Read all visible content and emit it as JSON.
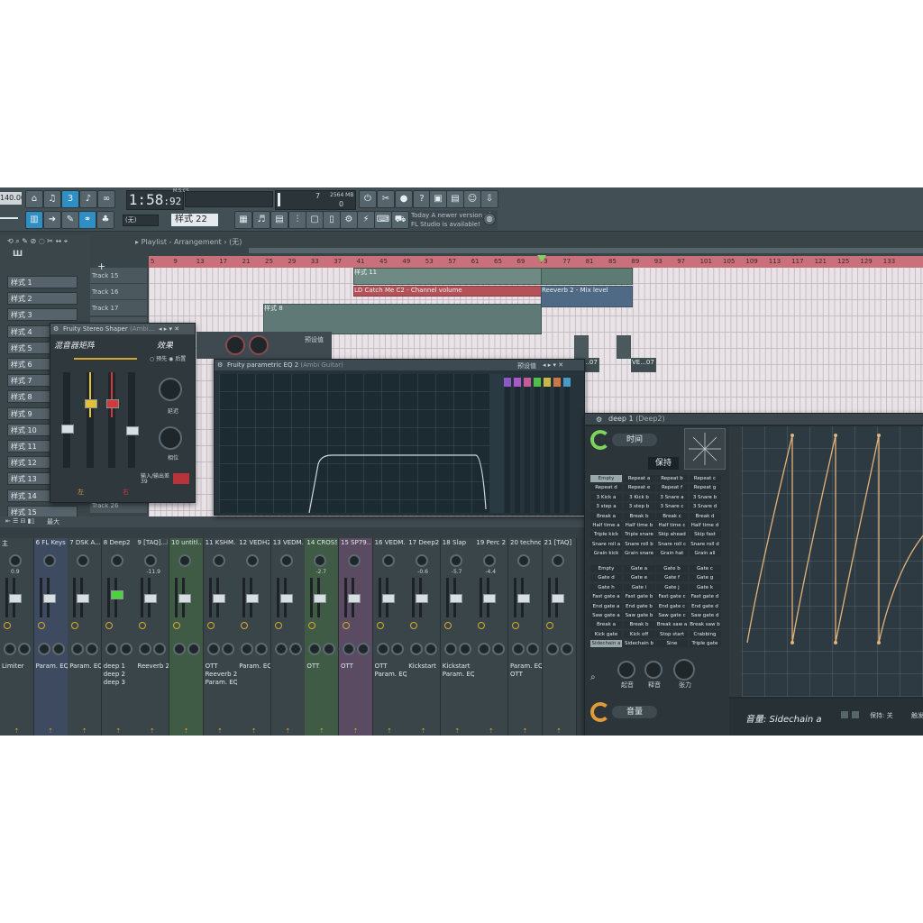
{
  "toolbar": {
    "tempo": "140.000",
    "time_main": "1:58",
    "time_sub": "92",
    "time_unit": "M:S:CS",
    "cpu_value": "7",
    "memory": "2564 MB",
    "poly_value": "0",
    "pattern_selector": "样式 22",
    "snap_value": "(无)",
    "news_line1": "Today  A newer version of",
    "news_line2": "FL Studio is available!"
  },
  "browser": {
    "patterns": [
      "样式 1",
      "样式 2",
      "样式 3",
      "样式 4",
      "样式 5",
      "样式 6",
      "样式 7",
      "样式 8",
      "样式 9",
      "样式 10",
      "样式 11",
      "样式 12",
      "样式 13",
      "样式 14",
      "样式 15"
    ]
  },
  "playlist": {
    "breadcrumb": "Playlist - Arrangement",
    "breadcrumb_sub": "(无)",
    "ruler": [
      "5",
      "9",
      "13",
      "17",
      "21",
      "25",
      "29",
      "33",
      "37",
      "41",
      "45",
      "49",
      "53",
      "57",
      "61",
      "65",
      "69",
      "73",
      "77",
      "81",
      "85",
      "89",
      "93",
      "97",
      "101",
      "105",
      "109",
      "113",
      "117",
      "121",
      "125",
      "129",
      "133"
    ],
    "tracks": [
      "Track 15",
      "Track 16",
      "Track 17",
      "",
      "",
      "",
      "",
      "",
      "",
      "",
      "",
      "",
      "",
      "",
      "Track 26"
    ],
    "clips": {
      "pattern_11": "样式 11",
      "lp_catch": "LD Catch Me C2 - Channel volume",
      "reverb": "Reeverb 2 - Mix level",
      "pattern_8": "样式 8",
      "ve_a": "VE...07",
      "ve_b": "VE...07"
    }
  },
  "stereo_shaper": {
    "title": "Fruity Stereo Shaper",
    "title_sub": "(Ambi...",
    "label_mix": "混音器矩阵",
    "label_effect": "效果",
    "radio_pre": "预先",
    "radio_post": "后置",
    "knob_delay": "延迟",
    "knob_phase": "相位",
    "io_label": "输入/输出差",
    "io_value": "39",
    "left": "左",
    "right": "右"
  },
  "eq": {
    "title": "Fruity parametric EQ 2",
    "title_sub": "(Ambi Guitar)",
    "preset_label": "预设值",
    "top_preset": "预设值"
  },
  "sidechain": {
    "title": "deep 1",
    "title_sub": "(Deep2)",
    "time_label": "时间",
    "hold_label": "保持",
    "volume_label": "音量",
    "presets_top": [
      [
        "Empty",
        "Repeat a",
        "Repeat b",
        "Repeat c"
      ],
      [
        "Repeat d",
        "Repeat e",
        "Repeat f",
        "Repeat g"
      ],
      [
        "3 Kick a",
        "3 Kick b",
        "3 Snare a",
        "3 Snare b"
      ],
      [
        "3 step a",
        "3 step b",
        "3 Snare c",
        "3 Snare d"
      ],
      [
        "Break a",
        "Break b",
        "Break c",
        "Break d"
      ],
      [
        "Half time a",
        "Half time b",
        "Half time c",
        "Half time d"
      ],
      [
        "Triple kick",
        "Triple snare",
        "Skip ahead",
        "Skip fast"
      ],
      [
        "Snare roll a",
        "Snare roll b",
        "Snare roll c",
        "Snare roll d"
      ],
      [
        "Grain kick",
        "Grain snare",
        "Grain hat",
        "Grain all"
      ]
    ],
    "presets_bottom": [
      [
        "Empty",
        "Gate a",
        "Gate b",
        "Gate c"
      ],
      [
        "Gate d",
        "Gate e",
        "Gate f",
        "Gate g"
      ],
      [
        "Gate h",
        "Gate i",
        "Gate j",
        "Gate k"
      ],
      [
        "Fast gate a",
        "Fast gate b",
        "Fast gate c",
        "Fast gate d"
      ],
      [
        "End gate a",
        "End gate b",
        "End gate c",
        "End gate d"
      ],
      [
        "Saw gate a",
        "Saw gate b",
        "Saw gate c",
        "Saw gate d"
      ],
      [
        "Break a",
        "Break b",
        "Break saw a",
        "Break saw b"
      ],
      [
        "Kick gate",
        "Kick off",
        "Stop start",
        "Crabbing"
      ],
      [
        "Sidechain a",
        "Sidechain b",
        "Sine",
        "Triple gate"
      ]
    ],
    "knob_attack": "起音",
    "knob_release": "释音",
    "knob_tension": "张力",
    "curve_label": "音量: Sidechain a",
    "hold_setting": "保持: 关",
    "trigger": "触发"
  },
  "mixer": {
    "header": "最大",
    "strips": [
      {
        "num": "",
        "name": "主",
        "db": "0.9",
        "slots": [
          "Limiter"
        ],
        "color": "#3a454a"
      },
      {
        "num": "6",
        "name": "FL Keys",
        "db": "",
        "slots": [
          "Param. EQ 2"
        ],
        "color": "#3e4a60"
      },
      {
        "num": "7",
        "name": "DSK A...am2",
        "db": "",
        "slots": [
          "Param. EQ 2"
        ],
        "color": "#3a454a"
      },
      {
        "num": "8",
        "name": "Deep2",
        "db": "",
        "slots": [
          "deep 1",
          "deep 2",
          "deep 3"
        ],
        "color": "#3a454a"
      },
      {
        "num": "9",
        "name": "[TAQ]...bstep",
        "db": "-11.9",
        "slots": [
          "Reeverb 2"
        ],
        "color": "#3a454a"
      },
      {
        "num": "10",
        "name": "untitl...aster",
        "db": "",
        "slots": [],
        "color": "#3f5a45"
      },
      {
        "num": "11",
        "name": "KSHM...05_A",
        "db": "",
        "slots": [
          "OTT",
          "Reeverb 2",
          "Param. EQ 2"
        ],
        "color": "#3a454a"
      },
      {
        "num": "12",
        "name": "VEDH2...43 C",
        "db": "",
        "slots": [
          "Param. EQ 2"
        ],
        "color": "#3a454a"
      },
      {
        "num": "13",
        "name": "VEDM...26 B",
        "db": "",
        "slots": [],
        "color": "#3a454a"
      },
      {
        "num": "14",
        "name": "CROSS...Killa",
        "db": "-2.7",
        "slots": [
          "OTT"
        ],
        "color": "#3f5a45"
      },
      {
        "num": "15",
        "name": "SP79...ps 21",
        "db": "",
        "slots": [
          "OTT"
        ],
        "color": "#5a4a62"
      },
      {
        "num": "16",
        "name": "VEDM...7 (C)",
        "db": "",
        "slots": [
          "OTT",
          "Param. EQ 2"
        ],
        "color": "#3a454a"
      },
      {
        "num": "17",
        "name": "Deep2",
        "db": "-0.6",
        "slots": [
          "Kickstart"
        ],
        "color": "#3a454a"
      },
      {
        "num": "18",
        "name": "Slap",
        "db": "-5.7",
        "slots": [
          "Kickstart",
          "Param. EQ 2"
        ],
        "color": "#3a454a"
      },
      {
        "num": "19",
        "name": "Perc 2",
        "db": "-4.4",
        "slots": [],
        "color": "#3a454a"
      },
      {
        "num": "20",
        "name": "techno",
        "db": "",
        "slots": [
          "Param. EQ 2",
          "OTT"
        ],
        "color": "#3a454a"
      },
      {
        "num": "21",
        "name": "[TAQ]",
        "db": "",
        "slots": [],
        "color": "#3a454a"
      }
    ]
  },
  "colors": {
    "accent": "#2f8fc4",
    "ruler": "#c9707a",
    "curve": "#e3b27a",
    "clip_green": "#5d7a73"
  }
}
